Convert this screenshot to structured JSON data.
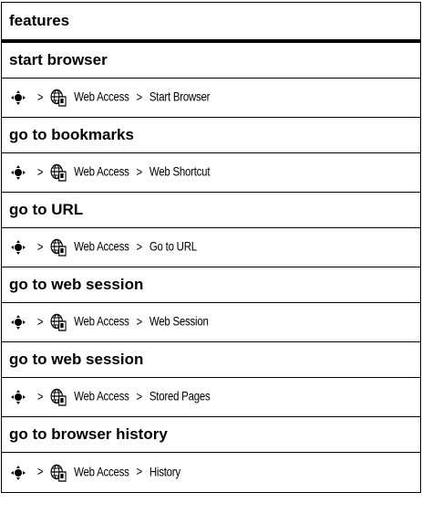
{
  "header": {
    "title": "features"
  },
  "features": [
    {
      "title": "start browser",
      "sep1": ">",
      "menu": "Web Access",
      "sep2": ">",
      "item": "Start Browser"
    },
    {
      "title": "go to bookmarks",
      "sep1": ">",
      "menu": "Web Access",
      "sep2": ">",
      "item": "Web Shortcut"
    },
    {
      "title": "go to URL",
      "sep1": ">",
      "menu": "Web Access",
      "sep2": ">",
      "item": "Go to URL"
    },
    {
      "title": "go to web session",
      "sep1": ">",
      "menu": "Web Access",
      "sep2": ">",
      "item": "Web Session"
    },
    {
      "title": "go to web session",
      "sep1": ">",
      "menu": "Web Access",
      "sep2": ">",
      "item": "Stored Pages"
    },
    {
      "title": "go to browser history",
      "sep1": ">",
      "menu": "Web Access",
      "sep2": ">",
      "item": "History"
    }
  ],
  "icons": {
    "nav": "nav-key-icon",
    "web": "web-access-icon"
  }
}
